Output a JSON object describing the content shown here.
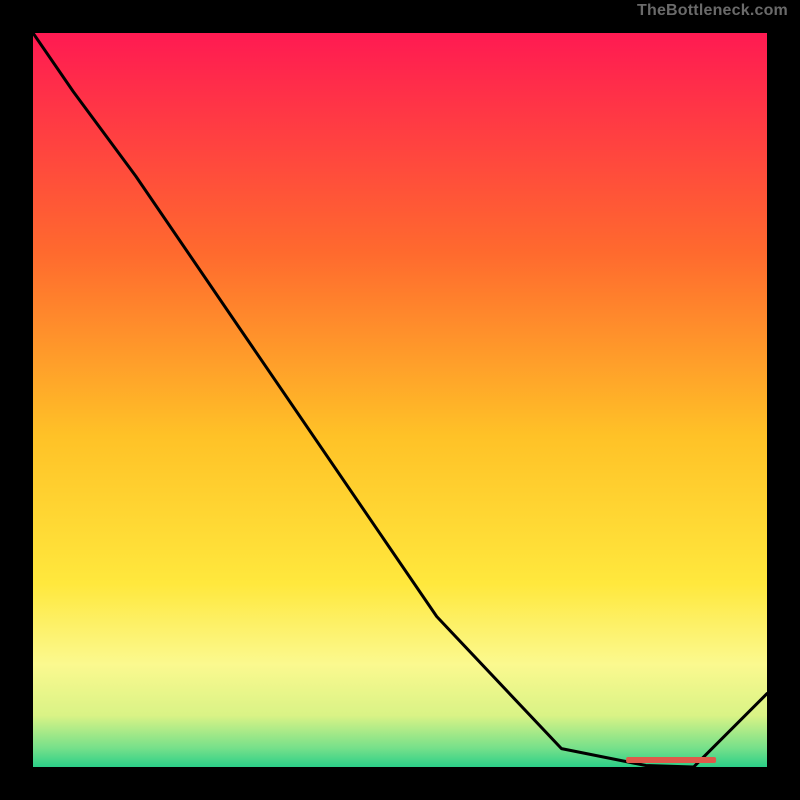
{
  "attribution": "TheBottleneck.com",
  "chart_data": {
    "type": "line",
    "x": [
      0.0,
      0.055,
      0.14,
      0.28,
      0.55,
      0.72,
      0.835,
      0.9,
      1.0
    ],
    "values": [
      1.0,
      0.92,
      0.805,
      0.6,
      0.205,
      0.025,
      0.002,
      0.0,
      0.1
    ],
    "optimum_point": 0.9,
    "xlim": [
      0,
      1
    ],
    "ylim": [
      0,
      1
    ],
    "background": {
      "type": "vertical-gradient",
      "stops": [
        {
          "offset": 0.0,
          "color": "#ff1a52"
        },
        {
          "offset": 0.3,
          "color": "#ff6a2e"
        },
        {
          "offset": 0.55,
          "color": "#ffc227"
        },
        {
          "offset": 0.75,
          "color": "#ffe83d"
        },
        {
          "offset": 0.86,
          "color": "#fbf98f"
        },
        {
          "offset": 0.93,
          "color": "#d9f386"
        },
        {
          "offset": 0.975,
          "color": "#74e08a"
        },
        {
          "offset": 1.0,
          "color": "#2bcf88"
        }
      ]
    },
    "optimum_marker_color": "#de5a4a",
    "curve_color": "#000000",
    "title": "",
    "xlabel": "",
    "ylabel": ""
  }
}
